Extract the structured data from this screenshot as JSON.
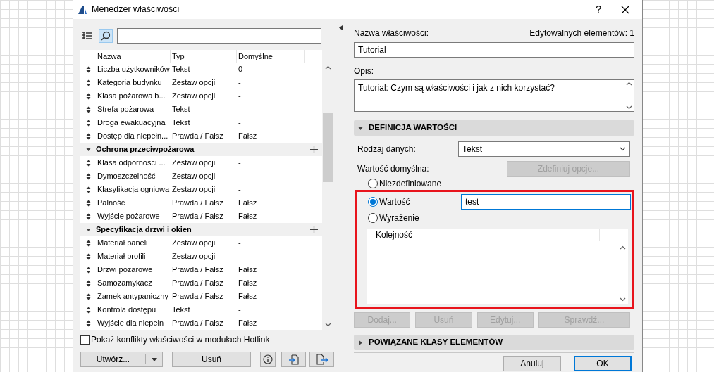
{
  "window": {
    "title": "Menedżer właściwości",
    "help": "?"
  },
  "property_list": {
    "columns": [
      "Nazwa",
      "Typ",
      "Domyślne"
    ],
    "items": [
      {
        "kind": "property",
        "name": "Liczba użytkowników",
        "type": "Tekst",
        "default": "0"
      },
      {
        "kind": "property",
        "name": "Kategoria budynku",
        "type": "Zestaw opcji",
        "default": "-"
      },
      {
        "kind": "property",
        "name": "Klasa pożarowa b...",
        "type": "Zestaw opcji",
        "default": "-"
      },
      {
        "kind": "property",
        "name": "Strefa pożarowa",
        "type": "Tekst",
        "default": "-"
      },
      {
        "kind": "property",
        "name": "Droga ewakuacyjna",
        "type": "Tekst",
        "default": "-"
      },
      {
        "kind": "property",
        "name": "Dostęp dla niepełn...",
        "type": "Prawda / Fałsz",
        "default": "Fałsz"
      },
      {
        "kind": "group",
        "name": "Ochrona przeciwpożarowa",
        "expanded": true,
        "children": [
          {
            "kind": "property",
            "name": "Klasa odporności ...",
            "type": "Zestaw opcji",
            "default": "-"
          },
          {
            "kind": "property",
            "name": "Dymoszczelność",
            "type": "Zestaw opcji",
            "default": "-"
          },
          {
            "kind": "property",
            "name": "Klasyfikacja ogniowa",
            "type": "Zestaw opcji",
            "default": "-"
          },
          {
            "kind": "property",
            "name": "Palność",
            "type": "Prawda / Fałsz",
            "default": "Fałsz"
          },
          {
            "kind": "property",
            "name": "Wyjście pożarowe",
            "type": "Prawda / Fałsz",
            "default": "Fałsz"
          }
        ]
      },
      {
        "kind": "group",
        "name": "Specyfikacja drzwi i okien",
        "expanded": true,
        "children": [
          {
            "kind": "property",
            "name": "Materiał paneli",
            "type": "Zestaw opcji",
            "default": "-"
          },
          {
            "kind": "property",
            "name": "Materiał profili",
            "type": "Zestaw opcji",
            "default": "-"
          },
          {
            "kind": "property",
            "name": "Drzwi pożarowe",
            "type": "Prawda / Fałsz",
            "default": "Fałsz"
          },
          {
            "kind": "property",
            "name": "Samozamykacz",
            "type": "Prawda / Fałsz",
            "default": "Fałsz"
          },
          {
            "kind": "property",
            "name": "Zamek antypaniczny",
            "type": "Prawda / Fałsz",
            "default": "Fałsz"
          },
          {
            "kind": "property",
            "name": "Kontrola dostępu",
            "type": "Tekst",
            "default": "-"
          },
          {
            "kind": "property",
            "name": "Wyjście dla niepełn",
            "type": "Prawda / Fałsz",
            "default": "Fałsz"
          }
        ]
      }
    ]
  },
  "hotlink_checkbox": {
    "label": "Pokaż konflikty właściwości w modułach Hotlink",
    "checked": false
  },
  "left_buttons": {
    "create": "Utwórz...",
    "delete": "Usuń"
  },
  "details": {
    "name_label": "Nazwa właściwości:",
    "editable_count": "Edytowalnych elementów: 1",
    "name_value": "Tutorial",
    "description_label": "Opis:",
    "description_value": "Tutorial: Czym są właściwości i jak z nich korzystać?",
    "value_definition": {
      "title": "DEFINICJA WARTOŚCI",
      "expanded": true
    },
    "data_type_label": "Rodzaj danych:",
    "data_type_value": "Tekst",
    "default_value_label": "Wartość domyślna:",
    "define_options_button": {
      "label": "Zdefiniuj opcje...",
      "disabled": true
    },
    "radios": [
      {
        "label": "Niezdefiniowane",
        "selected": false
      },
      {
        "label": "Wartość",
        "selected": true
      },
      {
        "label": "Wyrażenie",
        "selected": false
      }
    ],
    "value": "test",
    "list_column": "Kolejność",
    "list_buttons": [
      {
        "label": "Dodaj...",
        "disabled": true
      },
      {
        "label": "Usuń",
        "disabled": true
      },
      {
        "label": "Edytuj...",
        "disabled": true
      },
      {
        "label": "Sprawdź...",
        "disabled": true
      }
    ],
    "related_classes": {
      "title": "POWIĄZANE KLASY ELEMENTÓW",
      "expanded": false
    }
  },
  "footer_buttons": [
    {
      "label": "Anuluj",
      "default": false
    },
    {
      "label": "OK",
      "default": true
    }
  ]
}
